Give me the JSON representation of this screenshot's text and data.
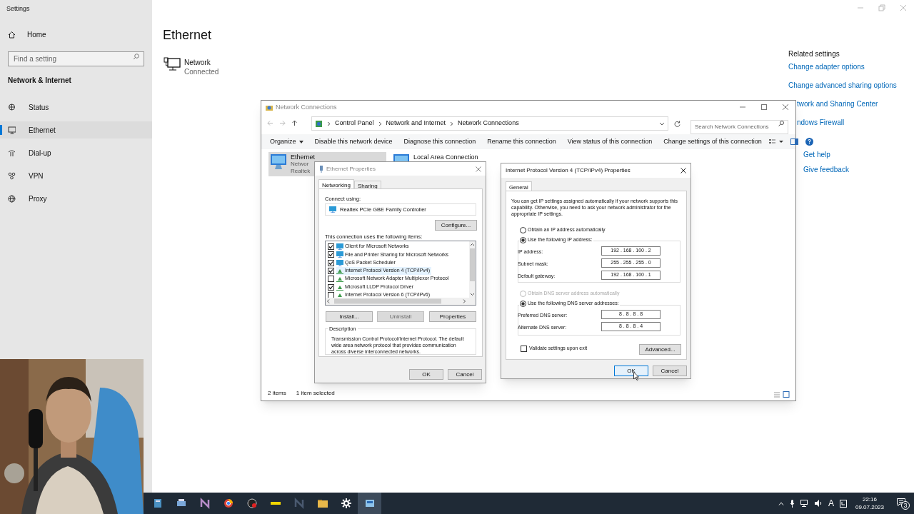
{
  "settings": {
    "title": "Settings",
    "home": "Home",
    "search": {
      "placeholder": "Find a setting"
    },
    "section": "Network & Internet",
    "nav": [
      {
        "label": "Status",
        "selected": false
      },
      {
        "label": "Ethernet",
        "selected": true
      },
      {
        "label": "Dial-up",
        "selected": false
      },
      {
        "label": "VPN",
        "selected": false
      },
      {
        "label": "Proxy",
        "selected": false
      }
    ],
    "page_title": "Ethernet",
    "network": {
      "name": "Network",
      "status": "Connected"
    },
    "related_heading": "Related settings",
    "related_links": [
      "Change adapter options",
      "Change advanced sharing options"
    ],
    "related_links_partial": [
      "twork and Sharing Center",
      "ndows Firewall"
    ],
    "help_links": [
      "Get help",
      "Give feedback"
    ]
  },
  "explorer": {
    "title": "Network Connections",
    "breadcrumb": [
      "Control Panel",
      "Network and Internet",
      "Network Connections"
    ],
    "search": {
      "placeholder": "Search Network Connections"
    },
    "toolbar": [
      "Organize",
      "Disable this network device",
      "Diagnose this connection",
      "Rename this connection",
      "View status of this connection",
      "Change settings of this connection"
    ],
    "items": [
      {
        "name": "Ethernet",
        "lines": [
          "Networ",
          "Realtek"
        ],
        "selected": true
      },
      {
        "name": "Local Area Connection",
        "selected": false
      }
    ],
    "status_bar": [
      "2 items",
      "1 item selected"
    ]
  },
  "ethernet_properties": {
    "title": "Ethernet Properties",
    "tabs": [
      {
        "label": "Networking",
        "selected": true
      },
      {
        "label": "Sharing",
        "selected": false
      }
    ],
    "connect_label": "Connect using:",
    "adapter": "Realtek PCIe GBE Family Controller",
    "configure": "Configure...",
    "items_label": "This connection uses the following items:",
    "items": [
      {
        "label": "Client for Microsoft Networks",
        "checked": true,
        "selected": false
      },
      {
        "label": "File and Printer Sharing for Microsoft Networks",
        "checked": true,
        "selected": false
      },
      {
        "label": "QoS Packet Scheduler",
        "checked": true,
        "selected": false
      },
      {
        "label": "Internet Protocol Version 4 (TCP/IPv4)",
        "checked": true,
        "selected": true
      },
      {
        "label": "Microsoft Network Adapter Multiplexor Protocol",
        "checked": false,
        "selected": false
      },
      {
        "label": "Microsoft LLDP Protocol Driver",
        "checked": true,
        "selected": false
      },
      {
        "label": "Internet Protocol Version 6 (TCP/IPv6)",
        "checked": false,
        "selected": false
      }
    ],
    "buttons": [
      {
        "label": "Install...",
        "disabled": false
      },
      {
        "label": "Uninstall",
        "disabled": true
      },
      {
        "label": "Properties",
        "disabled": false
      }
    ],
    "description_label": "Description",
    "description": "Transmission Control Protocol/Internet Protocol. The default wide area network protocol that provides communication across diverse interconnected networks.",
    "ok": "OK",
    "cancel": "Cancel"
  },
  "ipv4": {
    "title": "Internet Protocol Version 4 (TCP/IPv4) Properties",
    "tab": "General",
    "intro": "You can get IP settings assigned automatically if your network supports this capability. Otherwise, you need to ask your network administrator for the appropriate IP settings.",
    "ip_options": [
      {
        "label": "Obtain an IP address automatically",
        "selected": false,
        "disabled": false
      },
      {
        "label": "Use the following IP address:",
        "selected": true,
        "disabled": false
      }
    ],
    "ip_fields": [
      {
        "label": "IP address:",
        "value": "192 . 168 . 100 . 2"
      },
      {
        "label": "Subnet mask:",
        "value": "255 . 255 . 255 . 0"
      },
      {
        "label": "Default gateway:",
        "value": "192 . 168 . 100 . 1"
      }
    ],
    "dns_options": [
      {
        "label": "Obtain DNS server address automatically",
        "selected": false,
        "disabled": true
      },
      {
        "label": "Use the following DNS server addresses:",
        "selected": true,
        "disabled": false
      }
    ],
    "dns_fields": [
      {
        "label": "Preferred DNS server:",
        "value": "8 . 8 . 8 . 8"
      },
      {
        "label": "Alternate DNS server:",
        "value": "8 . 8 . 8 . 4"
      }
    ],
    "validate": {
      "label": "Validate settings upon exit",
      "checked": false
    },
    "advanced": "Advanced...",
    "ok": "OK",
    "cancel": "Cancel"
  },
  "taskbar": {
    "language": "A",
    "time": "22:16",
    "date": "09.07.2023",
    "notifications": "3"
  }
}
